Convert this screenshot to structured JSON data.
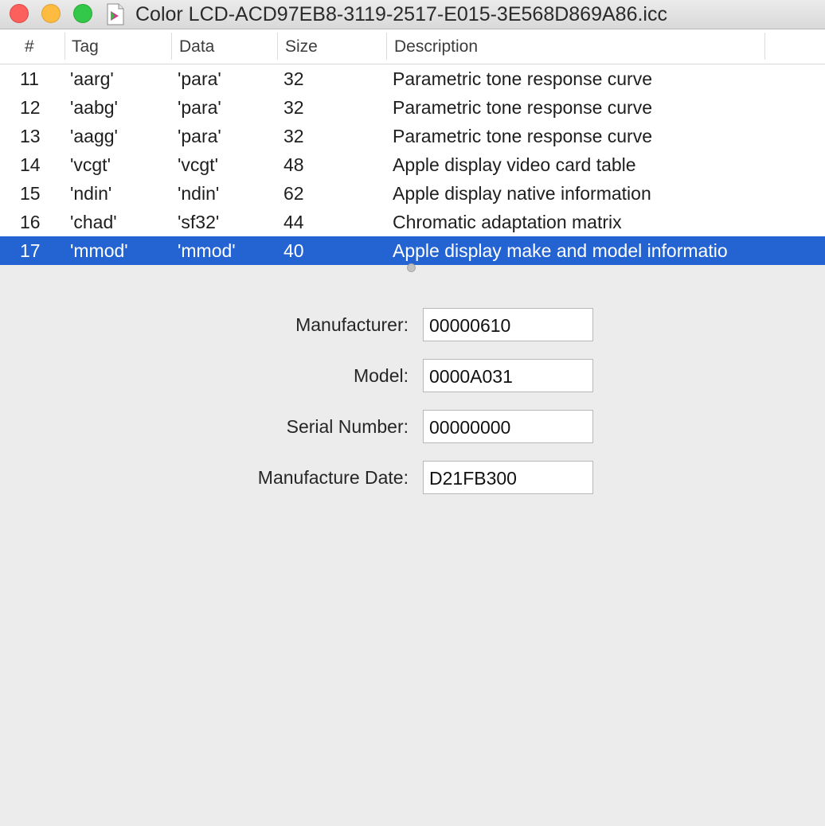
{
  "window": {
    "title": "Color LCD-ACD97EB8-3119-2517-E015-3E568D869A86.icc"
  },
  "table": {
    "columns": [
      "#",
      "Tag",
      "Data",
      "Size",
      "Description"
    ],
    "rows": [
      {
        "num": "11",
        "tag": "'aarg'",
        "data": "'para'",
        "size": "32",
        "desc": "Parametric tone response curve"
      },
      {
        "num": "12",
        "tag": "'aabg'",
        "data": "'para'",
        "size": "32",
        "desc": "Parametric tone response curve"
      },
      {
        "num": "13",
        "tag": "'aagg'",
        "data": "'para'",
        "size": "32",
        "desc": "Parametric tone response curve"
      },
      {
        "num": "14",
        "tag": "'vcgt'",
        "data": "'vcgt'",
        "size": "48",
        "desc": "Apple display video card table"
      },
      {
        "num": "15",
        "tag": "'ndin'",
        "data": "'ndin'",
        "size": "62",
        "desc": "Apple display native information"
      },
      {
        "num": "16",
        "tag": "'chad'",
        "data": "'sf32'",
        "size": "44",
        "desc": "Chromatic adaptation matrix"
      },
      {
        "num": "17",
        "tag": "'mmod'",
        "data": "'mmod'",
        "size": "40",
        "desc": "Apple display make and model informatio"
      }
    ],
    "selected_row": "17"
  },
  "details": {
    "manufacturer_label": "Manufacturer:",
    "manufacturer_value": "00000610",
    "model_label": "Model:",
    "model_value": "0000A031",
    "serial_label": "Serial Number:",
    "serial_value": "00000000",
    "date_label": "Manufacture Date:",
    "date_value": "D21FB300"
  },
  "colors": {
    "selection": "#2464d2",
    "close": "#fc605c",
    "minimize": "#fdbc40",
    "zoom": "#34c84a"
  },
  "icons": {
    "document": "color-profile-document-icon"
  }
}
